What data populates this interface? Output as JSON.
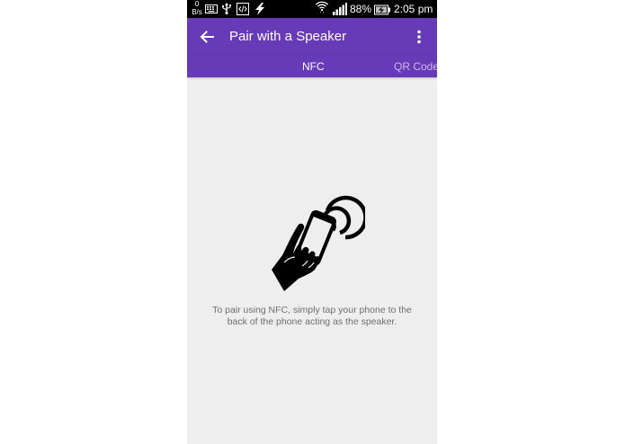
{
  "status_bar": {
    "net_speed_value": "0",
    "net_speed_unit": "B/s",
    "icons": [
      "keyboard-icon",
      "usb-icon",
      "developer-icon",
      "lightning-icon",
      "wifi-icon",
      "signal-icon",
      "battery-charging-icon"
    ],
    "battery_percent": "88%",
    "time": "2:05 pm"
  },
  "app_bar": {
    "title": "Pair with a Speaker",
    "background": "#673ab7",
    "back_icon": "arrow-left-icon",
    "menu_icon": "more-vertical-icon"
  },
  "tabs": [
    {
      "label": "NFC",
      "selected": true
    },
    {
      "label": "QR Code",
      "selected": false
    }
  ],
  "content": {
    "illustration_icon": "nfc-tap-hand-icon",
    "instructions": "To pair using NFC, simply tap your phone to the back of the phone acting as the speaker.",
    "background": "#eeeeee"
  }
}
